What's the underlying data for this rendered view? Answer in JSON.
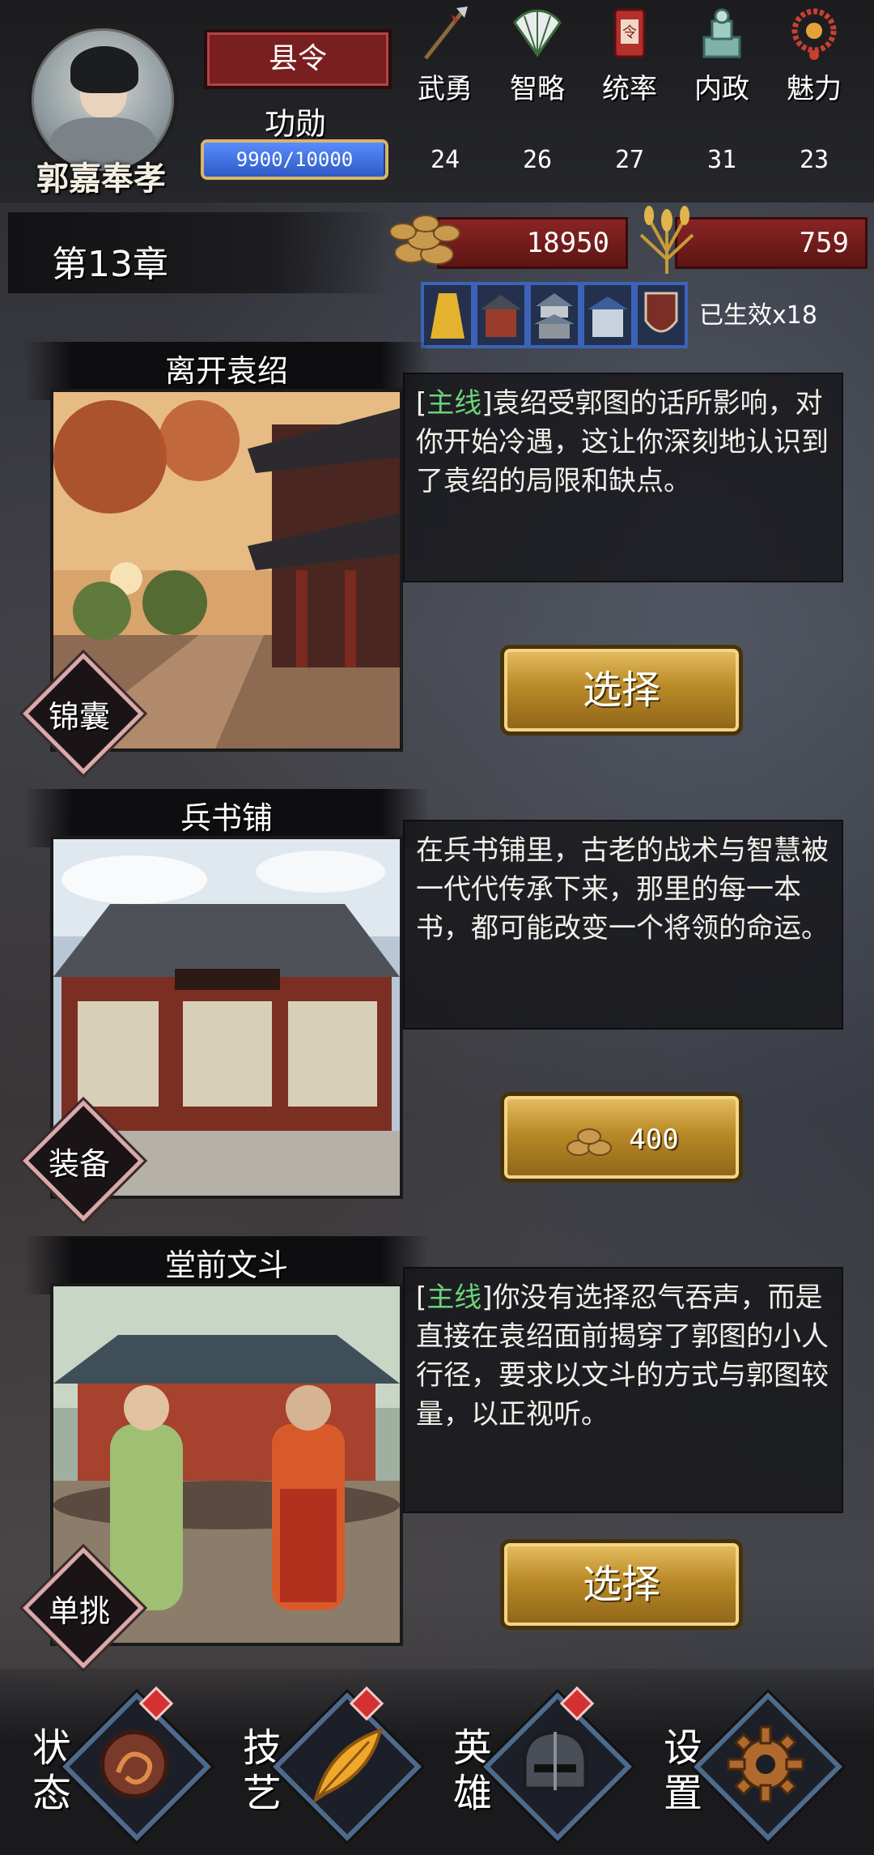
{
  "player": {
    "name": "郭嘉奉孝",
    "rank": "县令",
    "merit_label": "功勋",
    "merit_text": "9900/10000",
    "merit_fraction": 0.99
  },
  "stats": [
    {
      "label": "武勇",
      "value": "24",
      "icon": "spear-icon"
    },
    {
      "label": "智略",
      "value": "26",
      "icon": "fan-icon"
    },
    {
      "label": "统率",
      "value": "27",
      "icon": "command-token-icon"
    },
    {
      "label": "内政",
      "value": "31",
      "icon": "seal-icon"
    },
    {
      "label": "魅力",
      "value": "23",
      "icon": "necklace-icon"
    }
  ],
  "chapter": "第13章",
  "resources": {
    "coins": "18950",
    "grain": "759"
  },
  "items": [
    "robe-icon",
    "building-icon",
    "pagoda-icon",
    "palace-icon",
    "shield-icon"
  ],
  "births": "已生效x18",
  "events": [
    {
      "title": "离开袁绍",
      "tag": "主线",
      "desc": "袁绍受郭图的话所影响，对你开始冷遇，这让你深刻地认识到了袁绍的局限和缺点。",
      "category": "锦囊",
      "button": "选择"
    },
    {
      "title": "兵书铺",
      "tag": "",
      "desc": "在兵书铺里，古老的战术与智慧被一代代传承下来，那里的每一本书，都可能改变一个将领的命运。",
      "category": "装备",
      "cost": "400"
    },
    {
      "title": "堂前文斗",
      "tag": "主线",
      "desc": "你没有选择忍气吞声，而是直接在袁绍面前揭穿了郭图的小人行径，要求以文斗的方式与郭图较量，以正视听。",
      "category": "单挑",
      "button": "选择"
    }
  ],
  "nav": [
    {
      "label": "状态",
      "icon": "dragon-icon",
      "alert": true
    },
    {
      "label": "技艺",
      "icon": "feather-icon",
      "alert": true
    },
    {
      "label": "英雄",
      "icon": "helmet-icon",
      "alert": true
    },
    {
      "label": "设置",
      "icon": "gear-icon",
      "alert": false
    }
  ],
  "colors": {
    "main_tag": "#6cd27a",
    "rank_red": "#7a1f1f",
    "gold": "#d8b56a",
    "merit_blue": "#2d59c4"
  }
}
